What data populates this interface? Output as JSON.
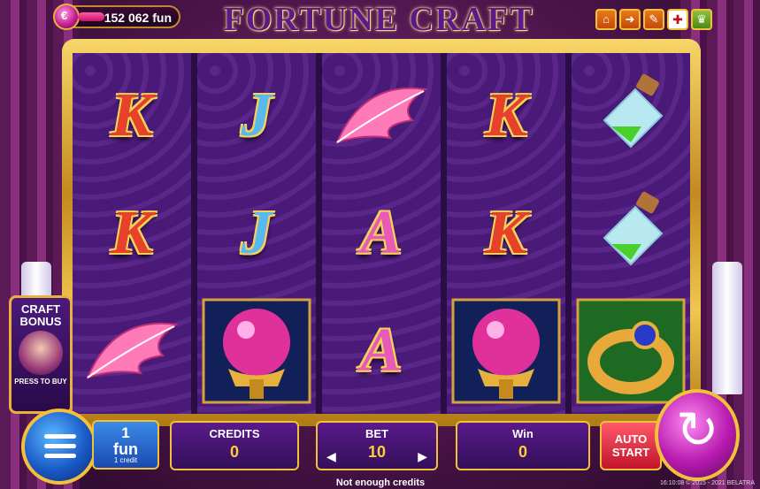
{
  "header": {
    "balance": "152 062 fun",
    "coin_symbol": "€",
    "title": "FORTUNE CRAFT",
    "buttons": [
      {
        "name": "home-icon",
        "glyph": "⌂"
      },
      {
        "name": "exit-icon",
        "glyph": "➜"
      },
      {
        "name": "edit-icon",
        "glyph": "✎"
      },
      {
        "name": "flag-uk-icon",
        "glyph": "✚"
      },
      {
        "name": "trophy-icon",
        "glyph": "♛"
      }
    ]
  },
  "reels": [
    [
      "K",
      "K",
      "feather"
    ],
    [
      "J",
      "J",
      "crystal-ball"
    ],
    [
      "feather",
      "A",
      "A"
    ],
    [
      "K",
      "K",
      "crystal-ball"
    ],
    [
      "potion",
      "potion",
      "ring"
    ]
  ],
  "craft_bonus": {
    "title": "CRAFT BONUS",
    "subtitle": "PRESS TO BUY"
  },
  "controls": {
    "coin_value": "1",
    "coin_unit": "fun",
    "coin_sub": "1 credit",
    "credits_label": "CREDITS",
    "credits_value": "0",
    "bet_label": "BET",
    "bet_value": "10",
    "win_label": "Win",
    "win_value": "0",
    "autostart_label": "AUTO START",
    "spin_glyph": "↻"
  },
  "message": "Not enough credits",
  "footer": "16:10:08  ©  2015 - 2021  BELATRA",
  "colors": {
    "frame_gold": "#f2c03a",
    "reel_bg": "#4a1a78",
    "title_purple": "#5a1a8a"
  }
}
